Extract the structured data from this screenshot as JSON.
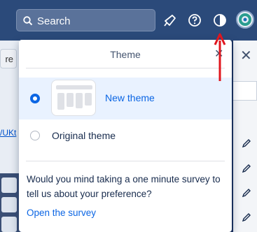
{
  "topbar": {
    "search_label": "Search",
    "icons": [
      "search-icon",
      "megaphone-icon",
      "help-icon",
      "theme-icon",
      "user-avatar"
    ]
  },
  "background": {
    "left_button_fragment": "re",
    "left_link_fragment": "/UKt"
  },
  "popup": {
    "title": "Theme",
    "options": [
      {
        "label": "New theme",
        "selected": true
      },
      {
        "label": "Original theme",
        "selected": false
      }
    ],
    "survey_text": "Would you mind taking a one minute survey to tell us about your preference?",
    "survey_link": "Open the survey"
  },
  "colors": {
    "topbar": "#2b4a7a",
    "accent": "#0c66e4",
    "selected_bg": "#e9f2ff",
    "annotation": "#e0161e"
  }
}
